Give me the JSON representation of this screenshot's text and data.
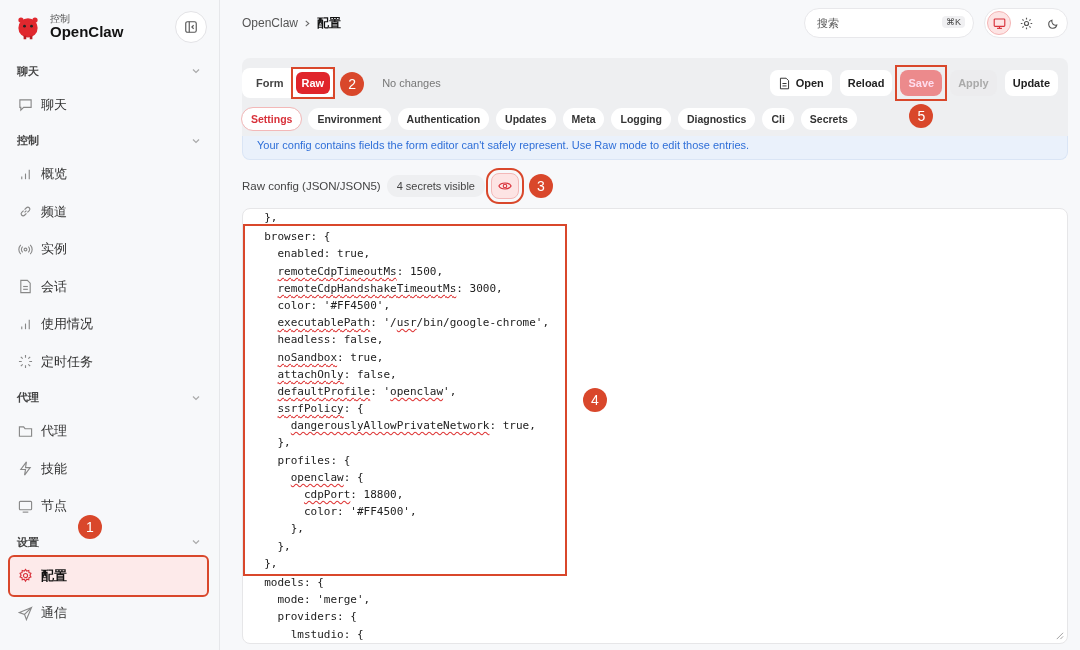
{
  "sidebar": {
    "brand": {
      "subtitle": "控制",
      "name": "OpenClaw"
    },
    "groups": [
      {
        "title": "聊天",
        "expanded": true,
        "items": [
          {
            "label": "聊天",
            "selected": false,
            "highlighted": false
          }
        ]
      },
      {
        "title": "控制",
        "expanded": true,
        "items": [
          {
            "label": "概览",
            "selected": false,
            "highlighted": false
          },
          {
            "label": "频道",
            "selected": false,
            "highlighted": false
          },
          {
            "label": "实例",
            "selected": false,
            "highlighted": false
          },
          {
            "label": "会话",
            "selected": false,
            "highlighted": false
          },
          {
            "label": "使用情况",
            "selected": false,
            "highlighted": false
          },
          {
            "label": "定时任务",
            "selected": false,
            "highlighted": false
          }
        ]
      },
      {
        "title": "代理",
        "expanded": true,
        "items": [
          {
            "label": "代理",
            "selected": false,
            "highlighted": false
          },
          {
            "label": "技能",
            "selected": false,
            "highlighted": false
          },
          {
            "label": "节点",
            "selected": false,
            "highlighted": false
          }
        ]
      },
      {
        "title": "设置",
        "expanded": true,
        "callout": "1",
        "items": [
          {
            "label": "配置",
            "selected": true,
            "highlighted": true
          },
          {
            "label": "通信",
            "selected": false,
            "highlighted": false
          }
        ]
      }
    ]
  },
  "header": {
    "breadcrumb": [
      "OpenClaw",
      "配置"
    ],
    "search": {
      "placeholder": "搜索",
      "shortcut": "⌘K"
    },
    "themes": [
      {
        "selected": true
      },
      {
        "selected": false
      },
      {
        "selected": false
      }
    ]
  },
  "toolbar": {
    "modes": [
      {
        "label": "Form",
        "selected": false
      },
      {
        "label": "Raw",
        "selected": true,
        "highlighted": true,
        "callout": "2"
      }
    ],
    "status": "No changes",
    "actions": [
      {
        "label": "Open",
        "kind": "icon",
        "disabled": false
      },
      {
        "label": "Reload",
        "kind": "plain",
        "disabled": false
      },
      {
        "label": "Save",
        "kind": "primary",
        "disabled": true,
        "highlighted": true,
        "callout": "5"
      },
      {
        "label": "Apply",
        "kind": "plain",
        "disabled": true
      },
      {
        "label": "Update",
        "kind": "plain",
        "disabled": false
      }
    ]
  },
  "sections": [
    {
      "label": "Settings",
      "selected": true
    },
    {
      "label": "Environment",
      "selected": false
    },
    {
      "label": "Authentication",
      "selected": false
    },
    {
      "label": "Updates",
      "selected": false
    },
    {
      "label": "Meta",
      "selected": false
    },
    {
      "label": "Logging",
      "selected": false
    },
    {
      "label": "Diagnostics",
      "selected": false
    },
    {
      "label": "Cli",
      "selected": false
    },
    {
      "label": "Secrets",
      "selected": false
    }
  ],
  "notice": "Your config contains fields the form editor can't safely represent. Use Raw mode to edit those entries.",
  "raw": {
    "label": "Raw config (JSON/JSON5)",
    "secrets": "4 secrets visible",
    "reveal": {
      "on": true,
      "highlighted": true,
      "callout": "3"
    }
  },
  "editor": {
    "before": [
      [
        {
          "text": "  },"
        }
      ]
    ],
    "highlight": {
      "callout": "4",
      "lines": [
        [
          {
            "text": "  browser: {"
          }
        ],
        [
          {
            "text": "    enabled: true,"
          }
        ],
        [
          {
            "text": "    remoteCdpTimeoutMs",
            "misspelled": true
          },
          {
            "text": ": 1500,"
          }
        ],
        [
          {
            "text": "    remoteCdpHandshakeTimeoutMs",
            "misspelled": true
          },
          {
            "text": ": 3000,"
          }
        ],
        [
          {
            "text": "    color: '#FF4500',"
          }
        ],
        [
          {
            "text": "    executablePath",
            "misspelled": true
          },
          {
            "text": ": '/"
          },
          {
            "text": "usr",
            "misspelled": true
          },
          {
            "text": "/bin/google-chrome',"
          }
        ],
        [
          {
            "text": "    headless: false,"
          }
        ],
        [
          {
            "text": "    noSandbox",
            "misspelled": true
          },
          {
            "text": ": true,"
          }
        ],
        [
          {
            "text": "    attachOnly",
            "misspelled": true
          },
          {
            "text": ": false,"
          }
        ],
        [
          {
            "text": "    defaultProfile",
            "misspelled": true
          },
          {
            "text": ": '"
          },
          {
            "text": "openclaw",
            "misspelled": true
          },
          {
            "text": "',"
          }
        ],
        [
          {
            "text": "    ssrfPolicy",
            "misspelled": true
          },
          {
            "text": ": {"
          }
        ],
        [
          {
            "text": "      dangerouslyAllowPrivateNetwork",
            "misspelled": true
          },
          {
            "text": ": true,"
          }
        ],
        [
          {
            "text": "    },"
          }
        ],
        [
          {
            "text": "    profiles: {"
          }
        ],
        [
          {
            "text": "      openclaw",
            "misspelled": true
          },
          {
            "text": ": {"
          }
        ],
        [
          {
            "text": "        cdpPort",
            "misspelled": true
          },
          {
            "text": ": 18800,"
          }
        ],
        [
          {
            "text": "        color: '#FF4500',"
          }
        ],
        [
          {
            "text": "      },"
          }
        ],
        [
          {
            "text": "    },"
          }
        ],
        [
          {
            "text": "  },"
          }
        ]
      ]
    },
    "after": [
      [
        {
          "text": "  models: {"
        }
      ],
      [
        {
          "text": "    mode: 'merge',"
        }
      ],
      [
        {
          "text": "    providers: {"
        }
      ],
      [
        {
          "text": "      lmstudio: {"
        }
      ]
    ]
  }
}
